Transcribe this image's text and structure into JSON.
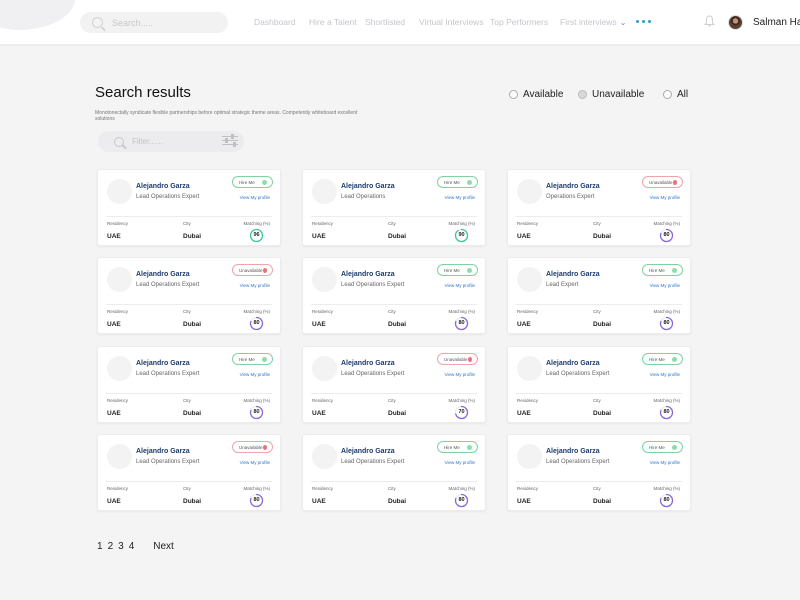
{
  "search": {
    "placeholder": "Search....."
  },
  "nav": {
    "items": [
      {
        "label": "Dashboard"
      },
      {
        "label": "Hire a Talent"
      },
      {
        "label": "Shortlisted"
      },
      {
        "label": "Virtual Interviews"
      },
      {
        "label": "Top Performers"
      },
      {
        "label": "First interviews",
        "chevron": "⌄"
      }
    ]
  },
  "user": {
    "name": "Salman Har"
  },
  "results": {
    "title": "Search results",
    "description": "Monotonectally syndicate flexible partnerships before optimal strategic theme areas. Competently whiteboard excellent solutions",
    "filter_placeholder": "Filter......",
    "radios": [
      {
        "label": "Available",
        "selected": false
      },
      {
        "label": "Unavailable",
        "selected": true
      },
      {
        "label": "All",
        "selected": false
      }
    ]
  },
  "colors": {
    "hire_border": "#7fd39e",
    "hire_dot": "#8fdcaa",
    "unavailable_border": "#f0a3a9",
    "unavailable_dot": "#e8737d",
    "name": "#1d3b6e",
    "link": "#2a76c8",
    "ring_green": "#3cc6a0",
    "ring_purple": "#8a6ad8"
  },
  "card_labels": {
    "residency": "Residency",
    "city": "City",
    "matching": "Matching (%)",
    "view_profile": "View My profile"
  },
  "cards": [
    {
      "name": "Alejandro Garza",
      "role": "Lead Operations Expert",
      "status": "Hire Me",
      "available": true,
      "residency": "UAE",
      "city": "Dubai",
      "matching": 96
    },
    {
      "name": "Alejandro Garza",
      "role": "Lead Operations",
      "status": "Hire Me",
      "available": true,
      "residency": "UAE",
      "city": "Dubai",
      "matching": 90
    },
    {
      "name": "Alejandro Garza",
      "role": "Operations Expert",
      "status": "Unavailable",
      "available": false,
      "residency": "UAE",
      "city": "Dubai",
      "matching": 80
    },
    {
      "name": "Alejandro Garza",
      "role": "Lead Operations Expert",
      "status": "Unavailable",
      "available": false,
      "residency": "UAE",
      "city": "Dubai",
      "matching": 80
    },
    {
      "name": "Alejandro Garza",
      "role": "Lead Operations Expert",
      "status": "Hire Me",
      "available": true,
      "residency": "UAE",
      "city": "Dubai",
      "matching": 80
    },
    {
      "name": "Alejandro Garza",
      "role": "Lead  Expert",
      "status": "Hire Me",
      "available": true,
      "residency": "UAE",
      "city": "Dubai",
      "matching": 80
    },
    {
      "name": "Alejandro Garza",
      "role": "Lead Operations Expert",
      "status": "Hire Me",
      "available": true,
      "residency": "UAE",
      "city": "Dubai",
      "matching": 80
    },
    {
      "name": "Alejandro Garza",
      "role": "Lead Operations Expert",
      "status": "Unavailable",
      "available": false,
      "residency": "UAE",
      "city": "Dubai",
      "matching": 70
    },
    {
      "name": "Alejandro Garza",
      "role": "Lead Operations Expert",
      "status": "Hire Me",
      "available": true,
      "residency": "UAE",
      "city": "Dubai",
      "matching": 80
    },
    {
      "name": "Alejandro Garza",
      "role": "Lead Operations Expert",
      "status": "Unavailable",
      "available": false,
      "residency": "UAE",
      "city": "Dubai",
      "matching": 80
    },
    {
      "name": "Alejandro Garza",
      "role": "Lead Operations Expert",
      "status": "Hire Me",
      "available": true,
      "residency": "UAE",
      "city": "Dubai",
      "matching": 80
    },
    {
      "name": "Alejandro Garza",
      "role": "Lead Operations Expert",
      "status": "Hire Me",
      "available": true,
      "residency": "UAE",
      "city": "Dubai",
      "matching": 80
    }
  ],
  "pagination": {
    "pages": [
      "1",
      "2",
      "3",
      "4"
    ],
    "next": "Next"
  }
}
